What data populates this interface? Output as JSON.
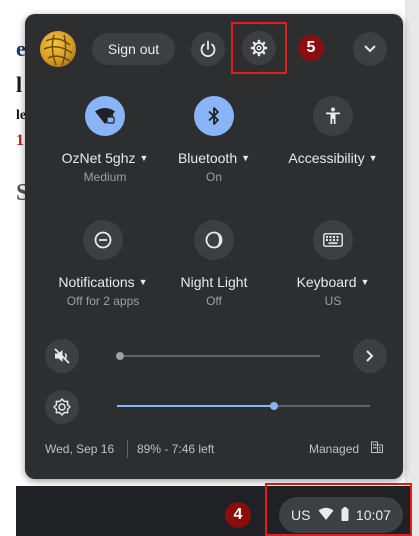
{
  "background_page": {
    "fragments": [
      "e",
      "l",
      "le",
      "1",
      "S"
    ]
  },
  "panel": {
    "sign_out_label": "Sign out",
    "tiles": [
      {
        "label": "OzNet 5ghz",
        "sublabel": "Medium",
        "has_dropdown": true,
        "active": true,
        "icon": "wifi-icon"
      },
      {
        "label": "Bluetooth",
        "sublabel": "On",
        "has_dropdown": true,
        "active": true,
        "icon": "bluetooth-icon"
      },
      {
        "label": "Accessibility",
        "sublabel": "",
        "has_dropdown": true,
        "active": false,
        "icon": "accessibility-icon"
      },
      {
        "label": "Notifications",
        "sublabel": "Off for 2 apps",
        "has_dropdown": true,
        "active": false,
        "icon": "notifications-icon"
      },
      {
        "label": "Night Light",
        "sublabel": "Off",
        "has_dropdown": false,
        "active": false,
        "icon": "night-light-icon"
      },
      {
        "label": "Keyboard",
        "sublabel": "US",
        "has_dropdown": true,
        "active": false,
        "icon": "keyboard-icon"
      }
    ],
    "volume": {
      "level": 0,
      "muted": true
    },
    "brightness": {
      "level": 0.62
    },
    "footer": {
      "date": "Wed, Sep 16",
      "battery": "89% - 7:46 left",
      "managed": "Managed"
    }
  },
  "annotations": {
    "settings_step": "5",
    "tray_step": "4"
  },
  "shelf": {
    "tray": {
      "ime": "US",
      "time": "10:07"
    }
  },
  "colors": {
    "panel_bg": "#2d2e30",
    "accent": "#8ab4f8",
    "highlight": "#e01e1e",
    "badge": "#8b0e0e",
    "shelf": "#202124"
  }
}
